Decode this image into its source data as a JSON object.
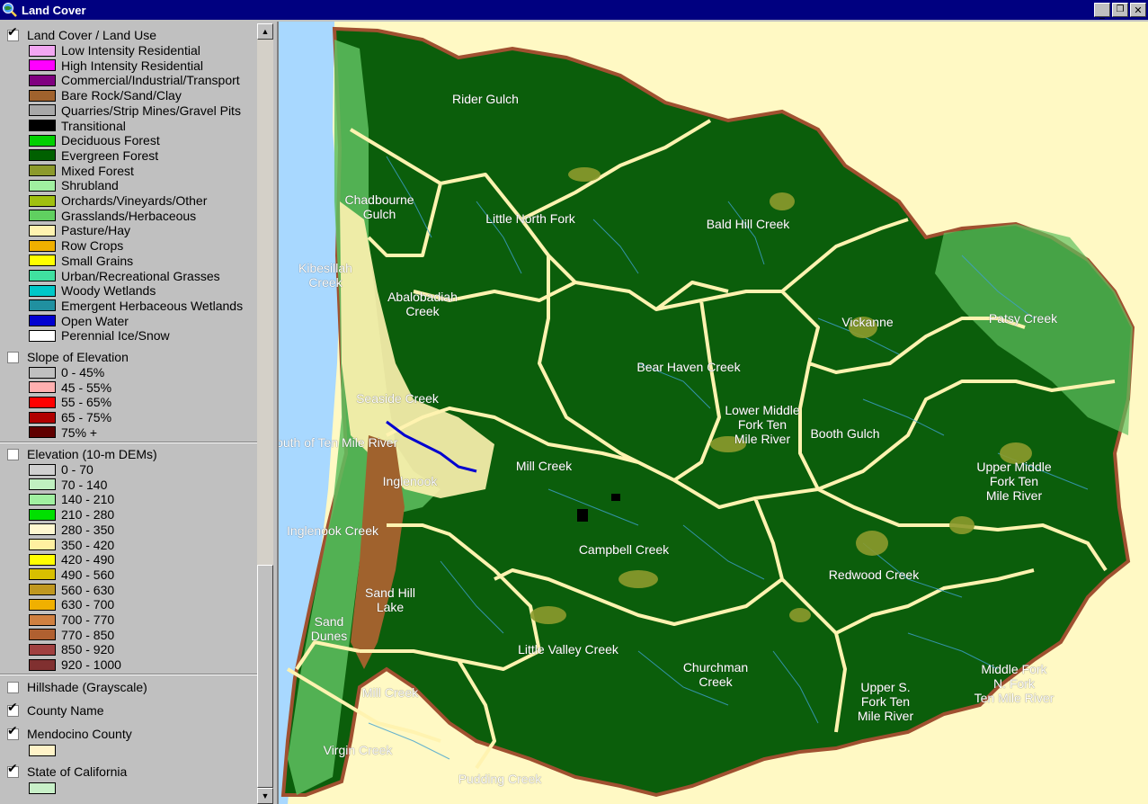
{
  "window": {
    "title": "Land Cover"
  },
  "legend": {
    "land_cover": {
      "label": "Land Cover / Land Use",
      "checked": true,
      "items": [
        {
          "label": "Low Intensity Residential",
          "color": "#f2a6f2"
        },
        {
          "label": "High Intensity Residential",
          "color": "#ff00ff"
        },
        {
          "label": "Commercial/Industrial/Transport",
          "color": "#800080"
        },
        {
          "label": "Bare Rock/Sand/Clay",
          "color": "#a0622d"
        },
        {
          "label": "Quarries/Strip Mines/Gravel Pits",
          "color": "#a8a8a8"
        },
        {
          "label": "Transitional",
          "color": "#000000"
        },
        {
          "label": "Deciduous Forest",
          "color": "#00d000"
        },
        {
          "label": "Evergreen Forest",
          "color": "#006000"
        },
        {
          "label": "Mixed Forest",
          "color": "#8c9a2c"
        },
        {
          "label": "Shrubland",
          "color": "#a0f0a0"
        },
        {
          "label": "Orchards/Vineyards/Other",
          "color": "#a0c010"
        },
        {
          "label": "Grasslands/Herbaceous",
          "color": "#60d060"
        },
        {
          "label": "Pasture/Hay",
          "color": "#fff3b0"
        },
        {
          "label": "Row Crops",
          "color": "#f0b000"
        },
        {
          "label": "Small Grains",
          "color": "#ffff00"
        },
        {
          "label": "Urban/Recreational Grasses",
          "color": "#40e0a0"
        },
        {
          "label": "Woody Wetlands",
          "color": "#00c8c8"
        },
        {
          "label": "Emergent Herbaceous Wetlands",
          "color": "#2090a0"
        },
        {
          "label": "Open Water",
          "color": "#0000d0"
        },
        {
          "label": "Perennial Ice/Snow",
          "color": "#ffffff"
        }
      ]
    },
    "slope": {
      "label": "Slope of Elevation",
      "checked": false,
      "items": [
        {
          "label": "0 - 45%",
          "color": "#c0c0c0"
        },
        {
          "label": "45 - 55%",
          "color": "#ffb0b0"
        },
        {
          "label": "55 - 65%",
          "color": "#ff0000"
        },
        {
          "label": "65 - 75%",
          "color": "#b00000"
        },
        {
          "label": "75% +",
          "color": "#600000"
        }
      ]
    },
    "elevation": {
      "label": "Elevation (10-m DEMs)",
      "checked": false,
      "items": [
        {
          "label": "0 - 70",
          "color": "#d0d0d0"
        },
        {
          "label": "70 - 140",
          "color": "#c0f0c0"
        },
        {
          "label": "140 - 210",
          "color": "#a0f0a0"
        },
        {
          "label": "210 - 280",
          "color": "#00e000"
        },
        {
          "label": "280 - 350",
          "color": "#fff8d0"
        },
        {
          "label": "350 - 420",
          "color": "#fff0a0"
        },
        {
          "label": "420 - 490",
          "color": "#ffff00"
        },
        {
          "label": "490 - 560",
          "color": "#d8c000"
        },
        {
          "label": "560 - 630",
          "color": "#c09820"
        },
        {
          "label": "630 - 700",
          "color": "#f0b000"
        },
        {
          "label": "700 - 770",
          "color": "#d08040"
        },
        {
          "label": "770 - 850",
          "color": "#b06030"
        },
        {
          "label": "850 - 920",
          "color": "#a04040"
        },
        {
          "label": "920 - 1000",
          "color": "#803030"
        }
      ]
    },
    "hillshade": {
      "label": "Hillshade (Grayscale)",
      "checked": false
    },
    "county_name": {
      "label": "County Name",
      "checked": true
    },
    "mendocino": {
      "label": "Mendocino County",
      "checked": true,
      "color": "#fff3c8"
    },
    "california": {
      "label": "State of California",
      "checked": true,
      "color": "#c8f0c8"
    }
  },
  "map": {
    "labels": [
      "Rider Gulch",
      "Chadbourne\nGulch",
      "Little North Fork",
      "Bald Hill Creek",
      "Kibesillah\nCreek",
      "Abalobadiah\nCreek",
      "Vickanne",
      "Patsy Creek",
      "Bear Haven Creek",
      "Seaside Creek",
      "Lower Middle\nFork Ten\nMile River",
      "Booth Gulch",
      "South of Ten Mile River",
      "Mill Creek",
      "Upper Middle\nFork Ten\nMile River",
      "Inglenook",
      "Inglenook Creek",
      "Campbell Creek",
      "Redwood Creek",
      "Sand Hill\nLake",
      "Sand\nDunes",
      "Little Valley Creek",
      "Churchman\nCreek",
      "Middle Fork\nN. Fork\nTen Mile River",
      "Upper S.\nFork Ten\nMile River",
      "Mill Creek",
      "Virgin Creek",
      "Pudding Creek"
    ]
  }
}
